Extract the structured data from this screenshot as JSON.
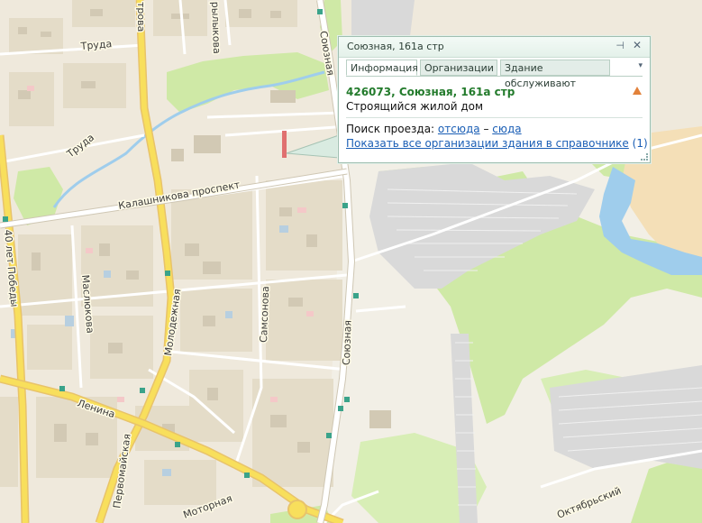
{
  "map": {
    "streets": {
      "trud_top": "Труда",
      "trud_left": "Труда",
      "kalashnikova": "Калашникова проспект",
      "soyuznaya_top": "Союзная",
      "soyuznaya_mid": "Союзная",
      "petrova": "трова",
      "krylova": "рылыкова",
      "40_let": "40 лет Победы",
      "maslyukova": "Маслюкова",
      "molodezhnaya": "Молодежная",
      "samsonova": "Самсонова",
      "lenina": "Ленина",
      "pervomayskaya": "Первомайская",
      "motornaya": "Моторная",
      "oktyabrsky": "Октябрьский"
    }
  },
  "popup": {
    "title": "Союзная, 161а стр",
    "pin_icon": "pin-icon",
    "close_icon": "close-icon",
    "tabs": [
      {
        "label": "Информация",
        "active": true
      },
      {
        "label": "Организации",
        "active": false
      },
      {
        "label": "Здание обслуживают",
        "active": false
      }
    ],
    "more_icon": "chevron-down-icon",
    "address": "426073, Союзная, 161а стр",
    "building_type": "Строящийся жилой дом",
    "route_label": "Поиск проезда:",
    "route_from": "отсюда",
    "route_dash": "–",
    "route_to": "сюда",
    "show_orgs": "Показать все организации здания в справочнике",
    "orgs_count": "(1)",
    "warning_color": "#e2813a",
    "address_color": "#237b2c",
    "link_color": "#1a5eb5"
  }
}
